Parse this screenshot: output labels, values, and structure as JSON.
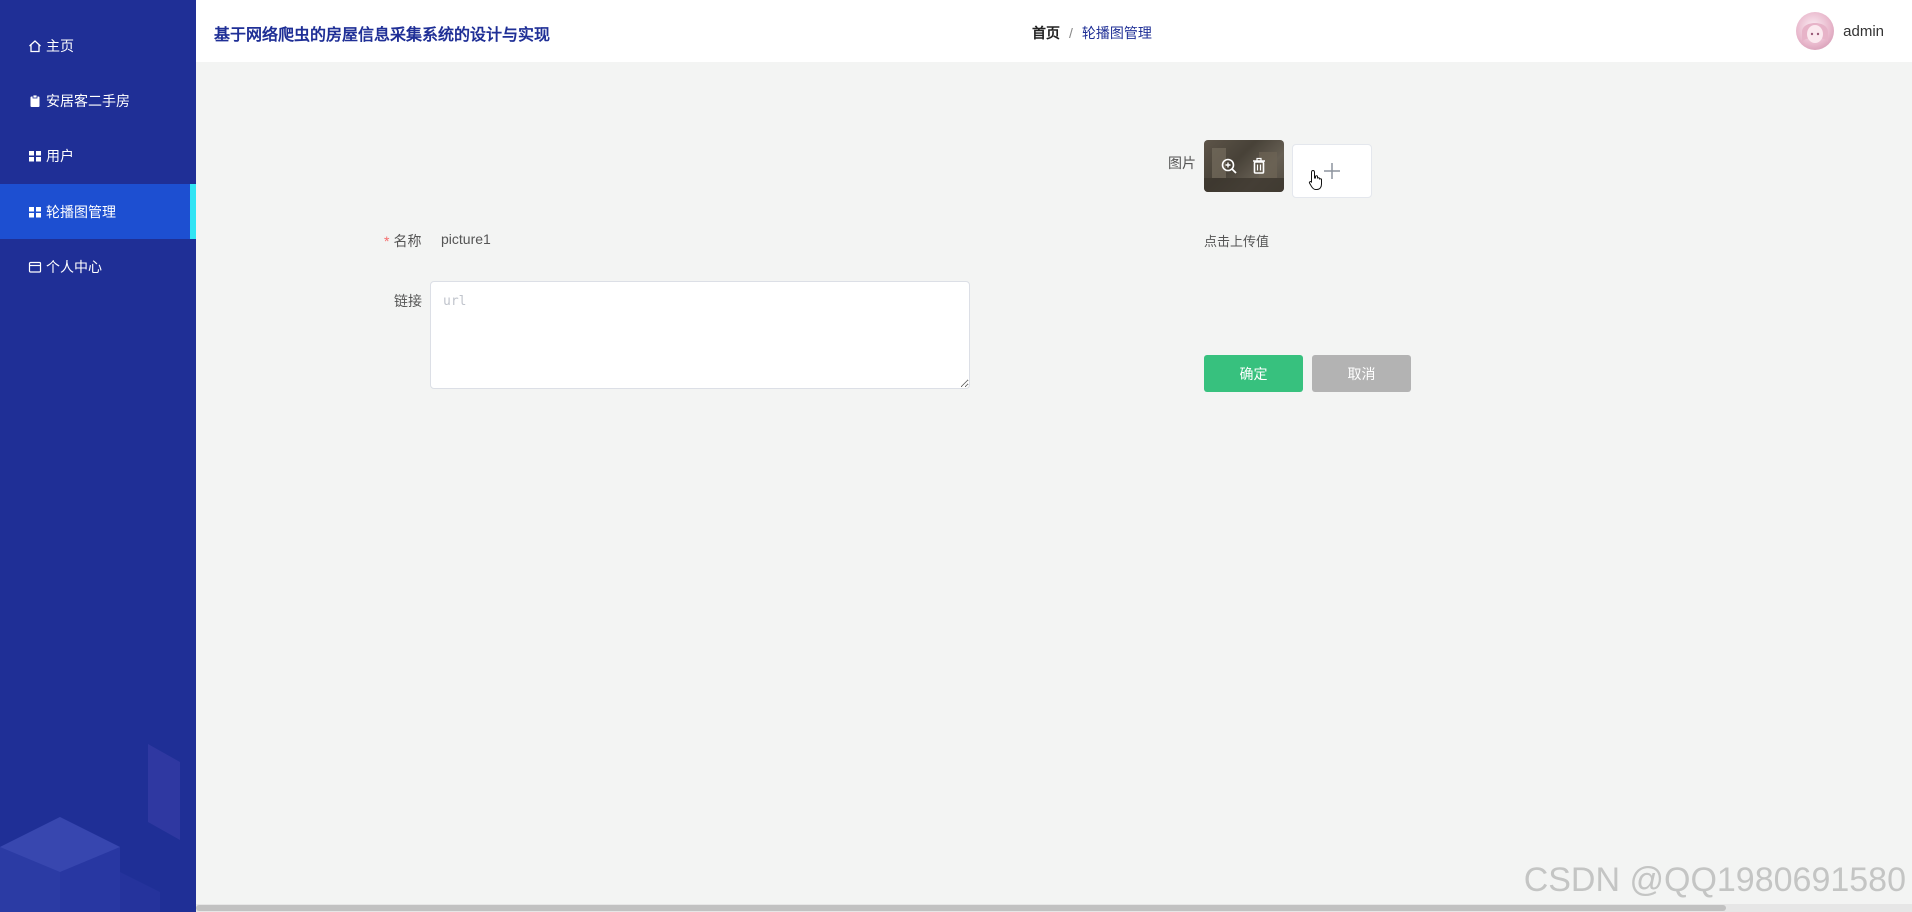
{
  "app": {
    "title": "基于网络爬虫的房屋信息采集系统的设计与实现"
  },
  "sidebar": {
    "items": [
      {
        "label": "主页",
        "icon": "home-icon"
      },
      {
        "label": "安居客二手房",
        "icon": "clipboard-icon"
      },
      {
        "label": "用户",
        "icon": "grid-icon"
      },
      {
        "label": "轮播图管理",
        "icon": "grid-icon",
        "active": true
      },
      {
        "label": "个人中心",
        "icon": "card-icon"
      }
    ]
  },
  "breadcrumb": {
    "home": "首页",
    "separator": "/",
    "current": "轮播图管理"
  },
  "user": {
    "name": "admin"
  },
  "form": {
    "image_label": "图片",
    "name_label": "名称",
    "required_mark": "*",
    "name_value": "picture1",
    "link_label": "链接",
    "link_placeholder": "url",
    "link_value": "",
    "upload_hint": "点击上传值",
    "confirm_label": "确定",
    "cancel_label": "取消"
  },
  "watermark": "CSDN @QQ1980691580",
  "colors": {
    "sidebar_bg": "#1f2f96",
    "sidebar_active": "#1d4fd1",
    "active_indicator": "#31e4f4",
    "confirm": "#37c17e",
    "cancel": "#b3b3b3"
  }
}
